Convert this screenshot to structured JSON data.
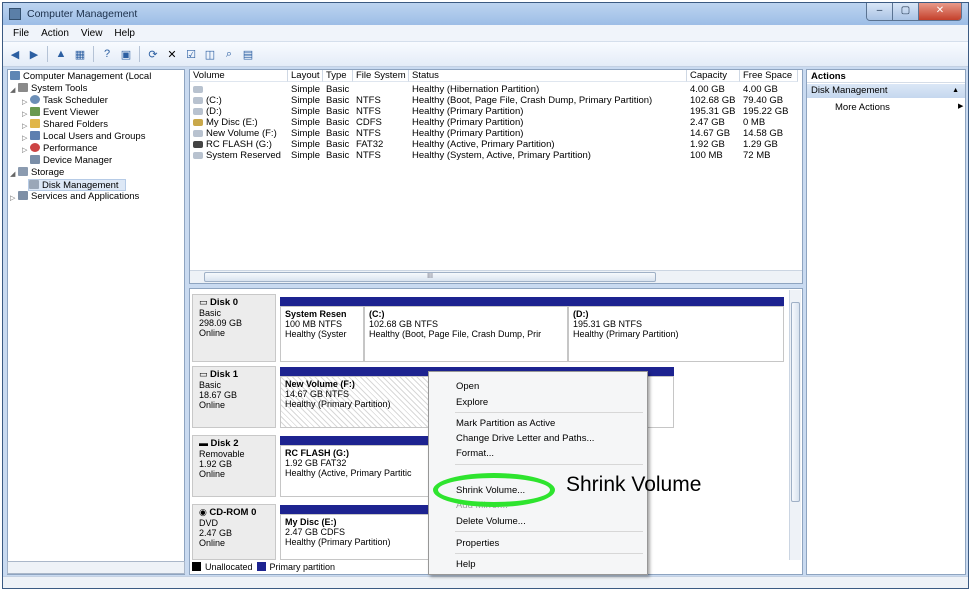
{
  "window": {
    "title": "Computer Management",
    "controls": [
      "–",
      "▢",
      "✕"
    ]
  },
  "menu": [
    "File",
    "Action",
    "View",
    "Help"
  ],
  "toolbar": [
    "back-icon",
    "forward-icon",
    "up-icon",
    "show-hide-tree-icon",
    "help-icon",
    "console-icon",
    "refresh-icon",
    "delete-icon",
    "properties-icon",
    "open-icon",
    "search-icon",
    "format-icon"
  ],
  "tree": {
    "root": "Computer Management (Local",
    "items": [
      {
        "label": "System Tools"
      },
      {
        "label": "Task Scheduler"
      },
      {
        "label": "Event Viewer"
      },
      {
        "label": "Shared Folders"
      },
      {
        "label": "Local Users and Groups"
      },
      {
        "label": "Performance"
      },
      {
        "label": "Device Manager"
      },
      {
        "label": "Storage"
      },
      {
        "label": "Disk Management"
      },
      {
        "label": "Services and Applications"
      }
    ]
  },
  "volumes": {
    "headers": [
      "Volume",
      "Layout",
      "Type",
      "File System",
      "Status",
      "Capacity",
      "Free Space"
    ],
    "rows": [
      [
        "",
        "Simple",
        "Basic",
        "",
        "Healthy (Hibernation Partition)",
        "4.00 GB",
        "4.00 GB"
      ],
      [
        "(C:)",
        "Simple",
        "Basic",
        "NTFS",
        "Healthy (Boot, Page File, Crash Dump, Primary Partition)",
        "102.68 GB",
        "79.40 GB"
      ],
      [
        "(D:)",
        "Simple",
        "Basic",
        "NTFS",
        "Healthy (Primary Partition)",
        "195.31 GB",
        "195.22 GB"
      ],
      [
        "My Disc (E:)",
        "Simple",
        "Basic",
        "CDFS",
        "Healthy (Primary Partition)",
        "2.47 GB",
        "0 MB"
      ],
      [
        "New Volume (F:)",
        "Simple",
        "Basic",
        "NTFS",
        "Healthy (Primary Partition)",
        "14.67 GB",
        "14.58 GB"
      ],
      [
        "RC FLASH (G:)",
        "Simple",
        "Basic",
        "FAT32",
        "Healthy (Active, Primary Partition)",
        "1.92 GB",
        "1.29 GB"
      ],
      [
        "System Reserved",
        "Simple",
        "Basic",
        "NTFS",
        "Healthy (System, Active, Primary Partition)",
        "100 MB",
        "72 MB"
      ]
    ],
    "scroll_label": "III"
  },
  "disks": {
    "disk0": {
      "name": "Disk 0",
      "type": "Basic",
      "size": "298.09 GB",
      "status": "Online",
      "parts": [
        {
          "title": "System Resen",
          "line2": "100 MB NTFS",
          "line3": "Healthy (Syster"
        },
        {
          "title": "(C:)",
          "line2": "102.68 GB NTFS",
          "line3": "Healthy (Boot, Page File, Crash Dump, Prir"
        },
        {
          "title": "(D:)",
          "line2": "195.31 GB NTFS",
          "line3": "Healthy (Primary Partition)"
        }
      ]
    },
    "disk1": {
      "name": "Disk 1",
      "type": "Basic",
      "size": "18.67 GB",
      "status": "Online",
      "parts": [
        {
          "title": "New Volume (F:)",
          "line2": "14.67 GB NTFS",
          "line3": "Healthy (Primary Partition)"
        }
      ]
    },
    "disk2": {
      "name": "Disk 2",
      "type": "Removable",
      "size": "1.92 GB",
      "status": "Online",
      "parts": [
        {
          "title": "RC FLASH (G:)",
          "line2": "1.92 GB FAT32",
          "line3": "Healthy (Active, Primary Partitic"
        }
      ]
    },
    "cdrom0": {
      "name": "CD-ROM 0",
      "type": "DVD",
      "size": "2.47 GB",
      "status": "Online",
      "parts": [
        {
          "title": "My Disc (E:)",
          "line2": "2.47 GB CDFS",
          "line3": "Healthy (Primary Partition)"
        }
      ]
    },
    "legend": {
      "unallocated": "Unallocated",
      "primary": "Primary partition",
      "unallocated_color": "#000000",
      "primary_color": "#1d2390"
    }
  },
  "actions": {
    "header": "Actions",
    "section": "Disk Management",
    "more": "More Actions"
  },
  "context_menu": {
    "items": [
      "Open",
      "Explore",
      "Mark Partition as Active",
      "Change Drive Letter and Paths...",
      "Format...",
      "Shrink Volume...",
      "Add Mirror...",
      "Delete Volume...",
      "Properties",
      "Help"
    ],
    "disabled": [
      "Add Mirror..."
    ]
  },
  "callout": {
    "text": "Shrink Volume",
    "ring_color": "#2ee42e"
  }
}
